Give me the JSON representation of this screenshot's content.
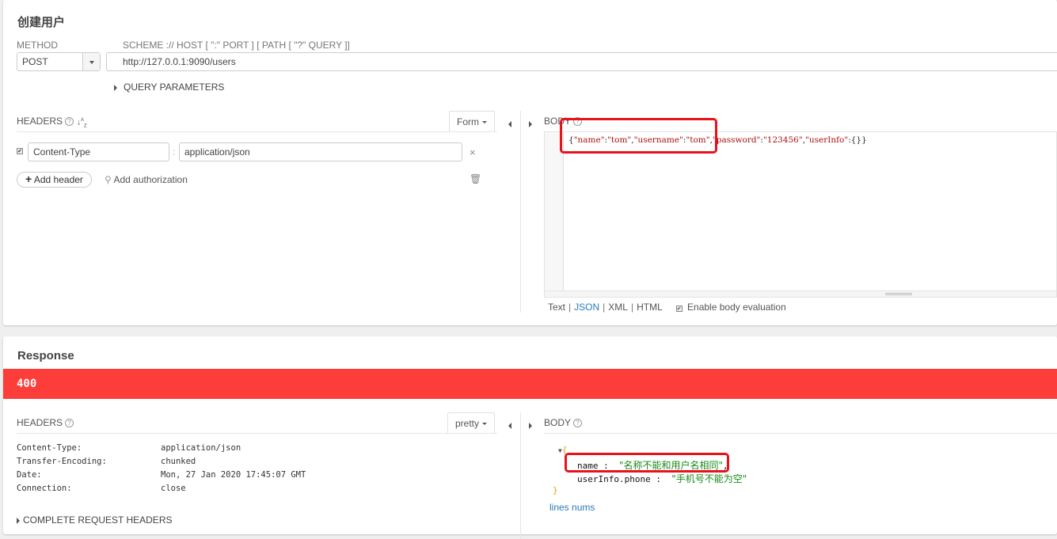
{
  "request": {
    "title": "创建用户",
    "method_label": "METHOD",
    "method_value": "POST",
    "url_label": "SCHEME :// HOST [ \":\" PORT ] [ PATH [ \"?\" QUERY ]]",
    "url_value": "http://127.0.0.1:9090/users",
    "query_parameters_label": "QUERY PARAMETERS",
    "headers": {
      "label": "HEADERS",
      "mode_button": "Form",
      "rows": [
        {
          "enabled": true,
          "name": "Content-Type",
          "value": "application/json"
        }
      ],
      "separator": ":",
      "add_header_label": "Add header",
      "add_authorization_label": "Add authorization"
    },
    "body": {
      "label": "BODY",
      "content_parts": [
        {
          "t": "{",
          "c": "p"
        },
        {
          "t": "\"name\"",
          "c": "s"
        },
        {
          "t": ":",
          "c": "p"
        },
        {
          "t": "\"tom\"",
          "c": "s"
        },
        {
          "t": ",",
          "c": "p"
        },
        {
          "t": "\"username\"",
          "c": "s"
        },
        {
          "t": ":",
          "c": "p"
        },
        {
          "t": "\"tom\"",
          "c": "s"
        },
        {
          "t": ",",
          "c": "p"
        },
        {
          "t": "\"password\"",
          "c": "s"
        },
        {
          "t": ":",
          "c": "p"
        },
        {
          "t": "\"123456\"",
          "c": "s"
        },
        {
          "t": ",",
          "c": "p"
        },
        {
          "t": "\"userInfo\"",
          "c": "s"
        },
        {
          "t": ":{}}",
          "c": "p"
        }
      ],
      "formats": [
        "Text",
        "JSON",
        "XML",
        "HTML"
      ],
      "selected_format": "JSON",
      "enable_body_evaluation_label": "Enable body evaluation",
      "enable_body_evaluation": true
    }
  },
  "response": {
    "title": "Response",
    "status_code": "400",
    "status_color": "#fc3d39",
    "headers": {
      "label": "HEADERS",
      "mode_button": "pretty",
      "rows": [
        {
          "name": "Content-Type:",
          "value": "application/json"
        },
        {
          "name": "Transfer-Encoding:",
          "value": "chunked"
        },
        {
          "name": "Date:",
          "value": "Mon, 27 Jan 2020 17:45:07 GMT"
        },
        {
          "name": "Connection:",
          "value": "close"
        }
      ],
      "complete_request_headers_label": "COMPLETE REQUEST HEADERS"
    },
    "body": {
      "label": "BODY",
      "open_brace": "{",
      "close_brace": "}",
      "fields": [
        {
          "key": "name",
          "sep": " :  ",
          "value": "\"名称不能和用户名相同\"",
          "trail": ","
        },
        {
          "key": "userInfo.phone",
          "sep": " :  ",
          "value": "\"手机号不能为空\"",
          "trail": ""
        }
      ],
      "lines_nums_label": "lines nums"
    }
  },
  "annotations": {
    "highlight_color": "#e8121b"
  }
}
